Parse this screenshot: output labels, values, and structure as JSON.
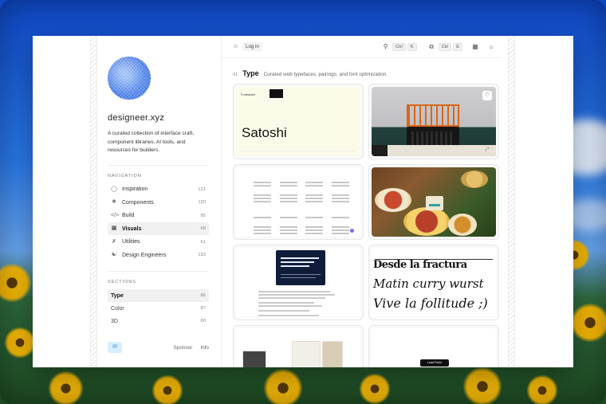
{
  "site": {
    "name": "designeer.xyz",
    "tagline": "A curated collection of interface craft, component libraries, AI tools, and resources for builders."
  },
  "navigation": {
    "label": "NAVIGATION",
    "items": [
      {
        "label": "Inspiration",
        "count": "121",
        "icon": "shield-icon"
      },
      {
        "label": "Components",
        "count": "120",
        "icon": "component-icon"
      },
      {
        "label": "Build",
        "count": "85",
        "icon": "code-icon"
      },
      {
        "label": "Visuals",
        "count": "68",
        "icon": "image-icon",
        "active": true
      },
      {
        "label": "Utilities",
        "count": "61",
        "icon": "tools-icon"
      },
      {
        "label": "Design Engineers",
        "count": "133",
        "icon": "users-icon"
      }
    ]
  },
  "sections": {
    "label": "SECTIONS",
    "items": [
      {
        "label": "Type",
        "count": "86",
        "active": true
      },
      {
        "label": "Color",
        "count": "87"
      },
      {
        "label": "3D",
        "count": "80"
      }
    ]
  },
  "footer": {
    "sponsor": "Sponsor",
    "info": "Info"
  },
  "topbar": {
    "login": "Log in",
    "search_keys": [
      "Ctrl",
      "K"
    ],
    "copy_keys": [
      "Ctrl",
      "E"
    ]
  },
  "heading": {
    "number": "01",
    "title": "Type",
    "description": "Curated web typefaces, pairings, and font optimization."
  },
  "cards": {
    "satoshi": {
      "brand": "Fontshare",
      "specimen": "Satoshi"
    },
    "calligraphy": {
      "line1": "Desde la fractura",
      "line2": "Matin curry wurst",
      "line3": "Vive la follitude ;)"
    },
    "button_card": {
      "button": "Load Fonts"
    }
  },
  "colors": {
    "accent": "#7c6cf0",
    "active_bg": "#f1f1f1",
    "comment": "#2b8ad8"
  }
}
